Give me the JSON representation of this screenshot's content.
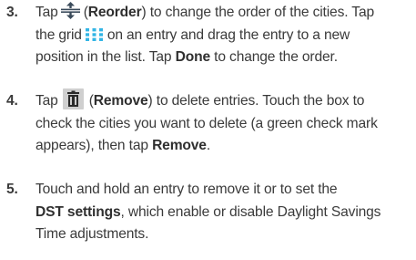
{
  "steps": [
    {
      "number": "3.",
      "line1_a": "Tap",
      "reorder_label": "Reorder",
      "line1_b": ") to change the order of the cities. Tap",
      "line2_a": "the grid",
      "line2_b": "on an entry and drag the entry to a new",
      "line3_a": "position in the list. Tap",
      "done_label": "Done",
      "line3_b": "to change the order."
    },
    {
      "number": "4.",
      "line1_a": "Tap",
      "remove_label": "Remove",
      "line1_b": ") to delete entries. Touch the box to",
      "line2": "check the cities you want to delete (a green check mark",
      "line3_a": "appears), then tap",
      "remove_label2": "Remove",
      "line3_b": "."
    },
    {
      "number": "5.",
      "line1": "Touch and hold an entry to remove it or to set the",
      "dst_label": "DST settings",
      "line2_b": ", which enable or disable Daylight Savings",
      "line3": "Time adjustments."
    }
  ],
  "icons": {
    "reorder": "reorder-icon",
    "grid": "grid-drag-icon",
    "remove": "trash-remove-icon"
  },
  "colors": {
    "text": "#3a3a3a",
    "reorder_icon": "#3a4a5a",
    "grid_icon": "#33b5e5",
    "remove_icon_bg": "#cfcfcf",
    "remove_icon_fg": "#2a2a2a"
  }
}
